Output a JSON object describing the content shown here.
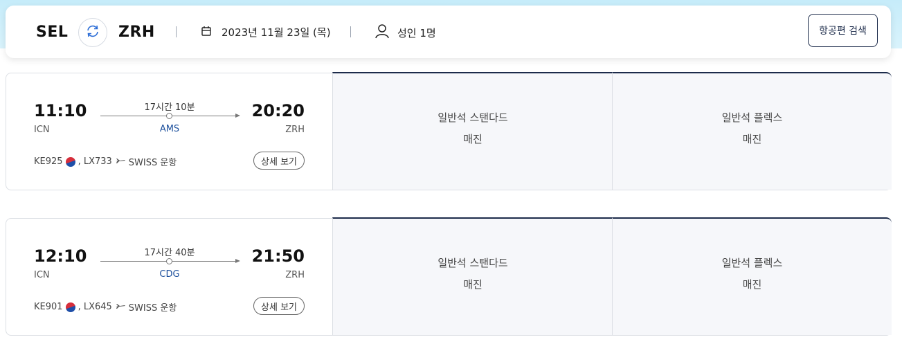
{
  "search": {
    "origin": "SEL",
    "destination": "ZRH",
    "date": "2023년 11월 23일 (목)",
    "passengers": "성인 1명",
    "search_button": "항공편 검색"
  },
  "flights": [
    {
      "dep_time": "11:10",
      "dep_code": "ICN",
      "arr_time": "20:20",
      "arr_code": "ZRH",
      "duration": "17시간 10분",
      "stop": "AMS",
      "flight_no_1": "KE925",
      "flight_no_2": ", LX733",
      "operator": "SWISS 운항",
      "detail_button": "상세 보기",
      "fares": [
        {
          "name": "일반석 스탠다드",
          "status": "매진"
        },
        {
          "name": "일반석 플렉스",
          "status": "매진"
        }
      ]
    },
    {
      "dep_time": "12:10",
      "dep_code": "ICN",
      "arr_time": "21:50",
      "arr_code": "ZRH",
      "duration": "17시간 40분",
      "stop": "CDG",
      "flight_no_1": "KE901",
      "flight_no_2": ", LX645",
      "operator": "SWISS 운항",
      "detail_button": "상세 보기",
      "fares": [
        {
          "name": "일반석 스탠다드",
          "status": "매진"
        },
        {
          "name": "일반석 플렉스",
          "status": "매진"
        }
      ]
    }
  ],
  "icons": {
    "swap": "swap-icon",
    "calendar": "calendar-icon",
    "passenger": "person-icon",
    "korea_flag": "korea-flag-icon",
    "partner_plane": "plane-icon"
  },
  "colors": {
    "accent": "#1c2b4a",
    "stop_text": "#1c4f9c",
    "band": "#c6ecfa",
    "fare_bg": "#f6f7fa"
  }
}
